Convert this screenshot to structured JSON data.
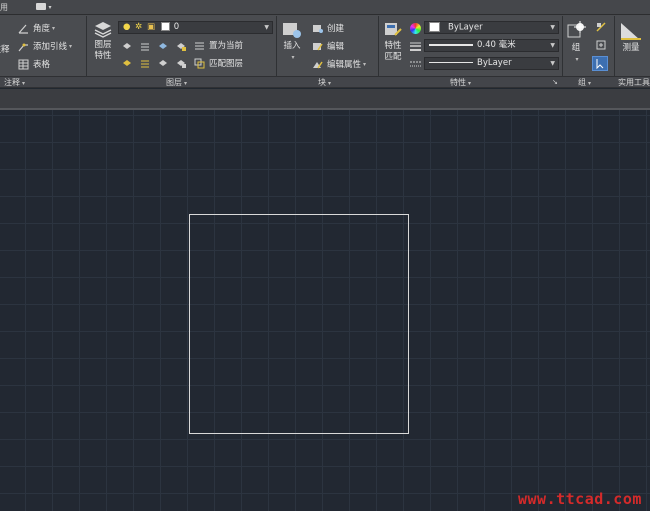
{
  "tab_label": "应用",
  "ribbon": {
    "annotation": {
      "title": "注释",
      "text_label": "注释",
      "angle": "角度",
      "add_leader": "添加引线",
      "table": "表格"
    },
    "layers": {
      "title": "图层",
      "layer_props_line1": "图层",
      "layer_props_line2": "特性",
      "layer_value": "0",
      "set_current": "置为当前",
      "match_layer": "匹配图层"
    },
    "block": {
      "title": "块",
      "insert": "插入",
      "create": "创建",
      "edit": "编辑",
      "edit_attributes": "编辑属性"
    },
    "properties": {
      "title": "特性",
      "match_line1": "特性",
      "match_line2": "匹配",
      "color": "ByLayer",
      "lineweight": "0.40 毫米",
      "linetype": "ByLayer"
    },
    "group": {
      "title": "组",
      "group_label": "组"
    },
    "utilities": {
      "title": "实用工具",
      "measure": "测量"
    }
  },
  "watermark": "www.ttcad.com"
}
